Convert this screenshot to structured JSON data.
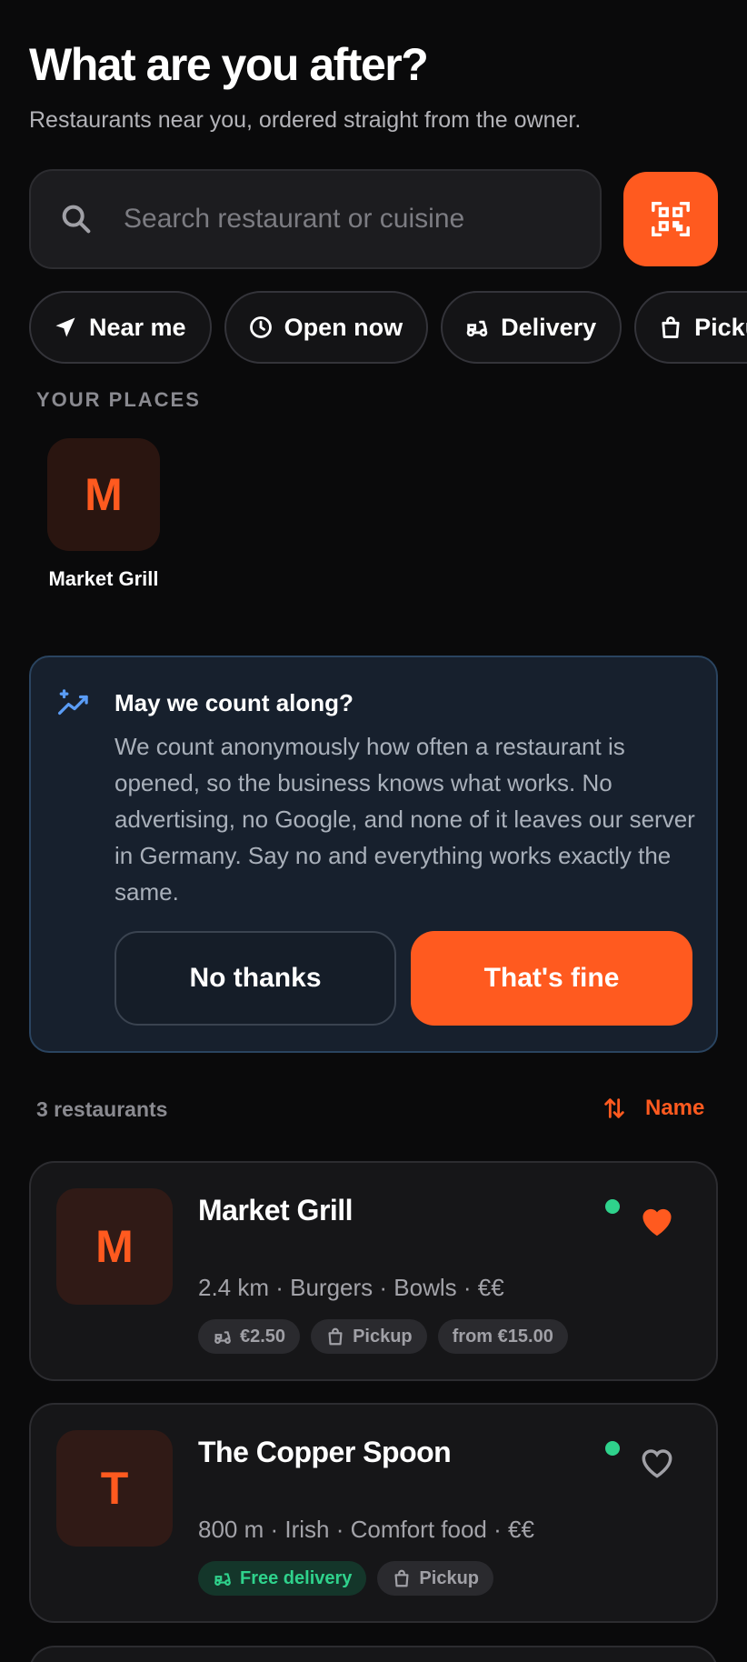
{
  "header": {
    "title": "What are you after?",
    "subtitle": "Restaurants near you, ordered straight from the owner."
  },
  "search": {
    "placeholder": "Search restaurant or cuisine",
    "icon": "search-icon",
    "qr_icon": "qr-code-icon"
  },
  "filters": [
    {
      "label": "Near me",
      "icon": "navigation-arrow-icon"
    },
    {
      "label": "Open now",
      "icon": "clock-icon"
    },
    {
      "label": "Delivery",
      "icon": "scooter-icon"
    },
    {
      "label": "Pickup",
      "icon": "shopping-bag-icon"
    }
  ],
  "your_places": {
    "label": "YOUR PLACES",
    "items": [
      {
        "initial": "M",
        "name": "Market Grill"
      }
    ]
  },
  "consent": {
    "title": "May we count along?",
    "body": "We count anonymously how often a restaurant is opened, so the business knows what works. No advertising, no Google, and none of it leaves our server in Germany. Say no and everything works exactly the same.",
    "decline_label": "No thanks",
    "accept_label": "That's fine"
  },
  "list": {
    "count_label": "3 restaurants",
    "sort_label": "Name"
  },
  "restaurants": [
    {
      "initial": "M",
      "name": "Market Grill",
      "open": true,
      "favorite": true,
      "meta": "2.4 km · Burgers · Bowls · €€",
      "tags": [
        {
          "label": "€2.50",
          "icon": "scooter-icon",
          "style": "neutral"
        },
        {
          "label": "Pickup",
          "icon": "shopping-bag-icon",
          "style": "neutral"
        },
        {
          "label": "from €15.00",
          "icon": "",
          "style": "neutral"
        }
      ]
    },
    {
      "initial": "T",
      "name": "The Copper Spoon",
      "open": true,
      "favorite": false,
      "meta": "800 m · Irish · Comfort food · €€",
      "tags": [
        {
          "label": "Free delivery",
          "icon": "scooter-icon",
          "style": "green"
        },
        {
          "label": "Pickup",
          "icon": "shopping-bag-icon",
          "style": "neutral"
        }
      ]
    }
  ],
  "colors": {
    "accent": "#ff5a1f",
    "open_status": "#2fd28c",
    "background": "#0a0a0b"
  }
}
